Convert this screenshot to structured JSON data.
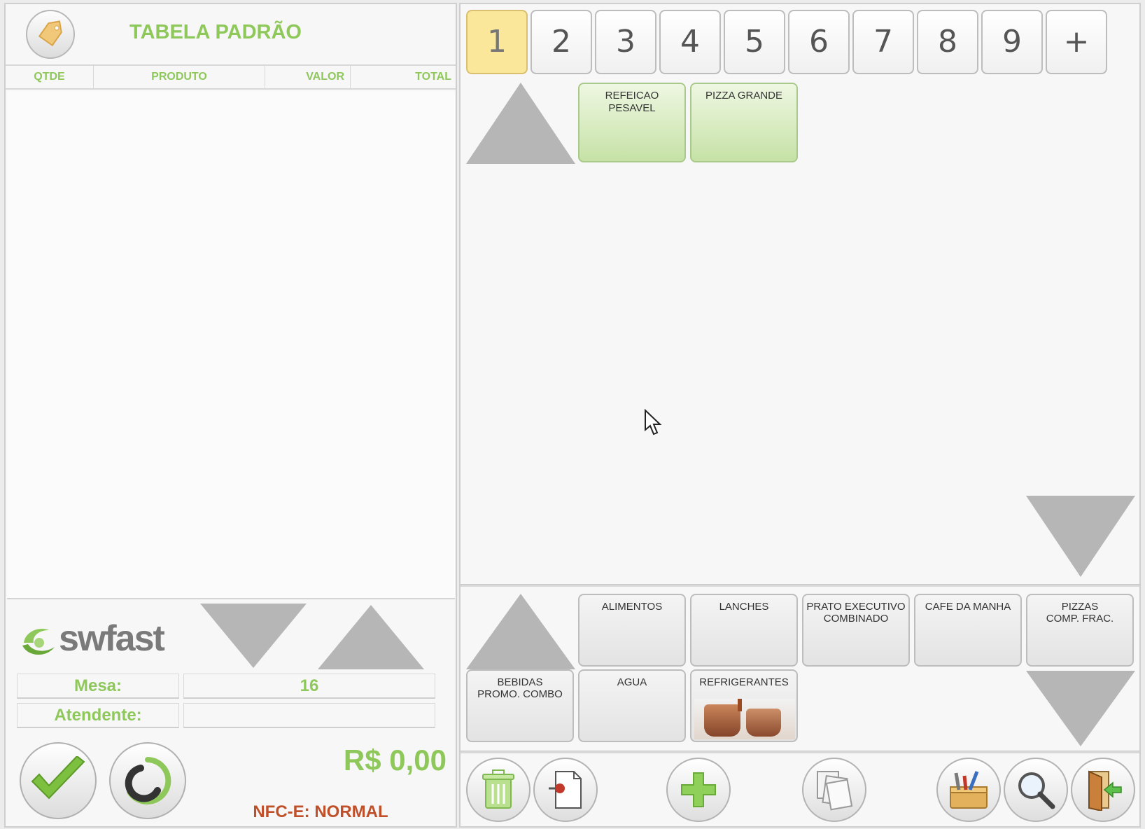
{
  "order_panel": {
    "price_table_title": "TABELA PADRÃO",
    "columns": [
      "QTDE",
      "PRODUTO",
      "VALOR",
      "TOTAL"
    ],
    "brand": "swfast",
    "mesa_label": "Mesa:",
    "mesa_value": "16",
    "atendente_label": "Atendente:",
    "atendente_value": "",
    "total": "R$ 0,00",
    "nfce_status": "NFC-E: NORMAL"
  },
  "page_tabs": [
    "1",
    "2",
    "3",
    "4",
    "5",
    "6",
    "7",
    "8",
    "9",
    "+"
  ],
  "active_tab": "1",
  "products": [
    {
      "label": "REFEICAO\nPESAVEL"
    },
    {
      "label": "PIZZA GRANDE"
    }
  ],
  "categories": [
    {
      "label": "ALIMENTOS"
    },
    {
      "label": "LANCHES"
    },
    {
      "label": "PRATO EXECUTIVO\nCOMBINADO"
    },
    {
      "label": "CAFE DA MANHA"
    },
    {
      "label": "PIZZAS\nCOMP. FRAC."
    },
    {
      "label": "BEBIDAS\nPROMO. COMBO"
    },
    {
      "label": "AGUA"
    },
    {
      "label": "REFRIGERANTES"
    }
  ],
  "colors": {
    "accent_green": "#8fc85a",
    "active_tab_yellow": "#fbe79a",
    "nfce_orange": "#c0502a",
    "product_green": "#c6e2a6"
  },
  "icons": {
    "price_tag": "tag-icon",
    "confirm": "checkmark-icon",
    "refresh": "swirl-refresh-icon",
    "delete": "trash-icon",
    "document": "document-pin-icon",
    "add": "plus-icon",
    "copy": "copy-pages-icon",
    "tools": "toolbox-icon",
    "search": "magnifier-icon",
    "exit": "exit-door-icon"
  }
}
